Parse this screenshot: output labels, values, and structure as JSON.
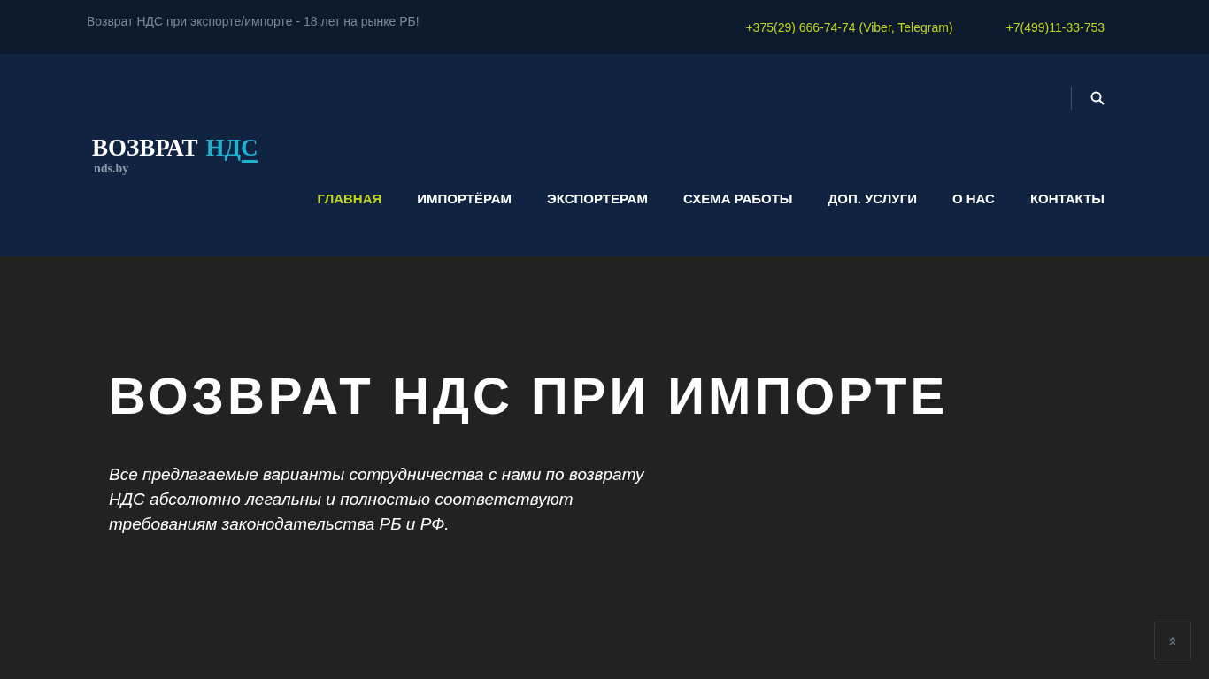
{
  "topbar": {
    "tagline": "Возврат НДС при экспорте/импорте - 18 лет на рынке РБ!",
    "phones": [
      "+375(29) 666-74-74 (Viber, Telegram)",
      "+7(499)11-33-753"
    ]
  },
  "logo": {
    "title": "ВОЗВРАТ",
    "accent": "НДС",
    "domain": "nds.by"
  },
  "nav": [
    {
      "label": "ГЛАВНАЯ",
      "selected": true
    },
    {
      "label": "ИМПОРТЁРАМ",
      "selected": false
    },
    {
      "label": "ЭКСПОРТЕРАМ",
      "selected": false
    },
    {
      "label": "СХЕМА РАБОТЫ",
      "selected": false
    },
    {
      "label": "ДОП. УСЛУГИ",
      "selected": false
    },
    {
      "label": "О НАС",
      "selected": false
    },
    {
      "label": "КОНТАКТЫ",
      "selected": false
    }
  ],
  "hero": {
    "title": "ВОЗВРАТ НДС ПРИ ИМПОРТЕ",
    "text": "Все предлагаемые варианты сотрудничества с нами по возврату НДС абсолютно легальны и полностью соответствуют требованиям законодательства РБ и РФ."
  }
}
